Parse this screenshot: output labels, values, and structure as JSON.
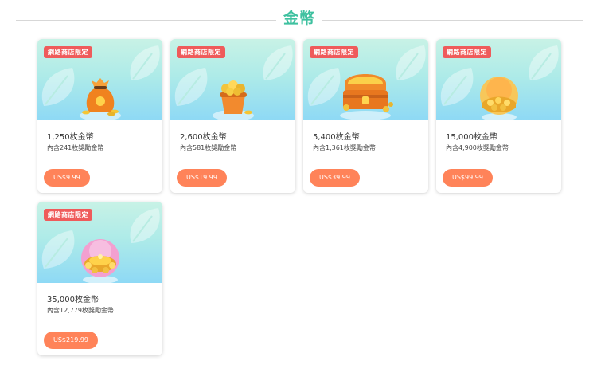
{
  "section": {
    "title": "金幣"
  },
  "colors": {
    "accent": "#3fc1a0",
    "badge": "#ef5b5b",
    "price_button": "#ff8359"
  },
  "cards": [
    {
      "badge": "網路商店限定",
      "name": "1,250枚金幣",
      "description": "內含241枚獎勵金幣",
      "price": "US$9.99",
      "image": "coin-bag-icon"
    },
    {
      "badge": "網路商店限定",
      "name": "2,600枚金幣",
      "description": "內含581枚獎勵金幣",
      "price": "US$19.99",
      "image": "coin-bucket-icon"
    },
    {
      "badge": "網路商店限定",
      "name": "5,400枚金幣",
      "description": "內含1,361枚獎勵金幣",
      "price": "US$39.99",
      "image": "coin-chest-icon"
    },
    {
      "badge": "網路商店限定",
      "name": "15,000枚金幣",
      "description": "內含4,900枚獎勵金幣",
      "price": "US$99.99",
      "image": "coin-pile-icon"
    },
    {
      "badge": "網路商店限定",
      "name": "35,000枚金幣",
      "description": "內含12,779枚獎勵金幣",
      "price": "US$219.99",
      "image": "coin-treasure-icon"
    }
  ]
}
